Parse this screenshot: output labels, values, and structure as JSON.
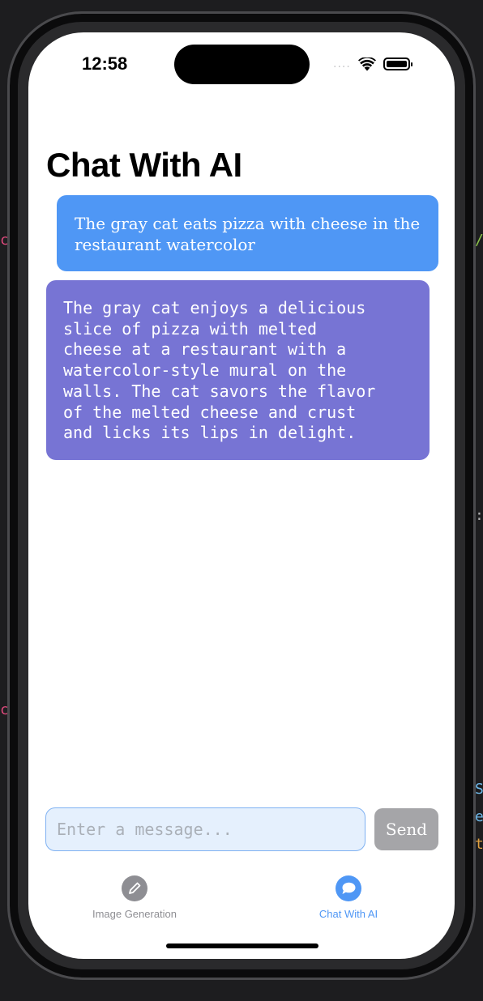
{
  "status_bar": {
    "time": "12:58",
    "signal": "....",
    "icons": [
      "wifi-icon",
      "battery-icon"
    ]
  },
  "page": {
    "title": "Chat With AI"
  },
  "messages": [
    {
      "role": "user",
      "text": "The gray cat eats pizza with cheese in the restaurant watercolor"
    },
    {
      "role": "assistant",
      "text": "The gray cat enjoys a delicious\nslice of pizza with melted\ncheese at a restaurant with a\nwatercolor-style mural on the\nwalls. The cat savors the flavor\nof the melted cheese and crust\nand licks its lips in delight."
    }
  ],
  "composer": {
    "placeholder": "Enter a message...",
    "value": "",
    "send_label": "Send"
  },
  "tab_bar": {
    "tabs": [
      {
        "label": "Image Generation",
        "icon": "pencil-icon",
        "selected": false
      },
      {
        "label": "Chat With AI",
        "icon": "chat-bubble-icon",
        "selected": true
      }
    ]
  },
  "colors": {
    "accent": "#4F97F5",
    "user_bubble": "#4F97F5",
    "assistant_bubble": "#7774D4",
    "send_disabled": "#A5A5A8",
    "tab_inactive": "#8E8E93"
  }
}
